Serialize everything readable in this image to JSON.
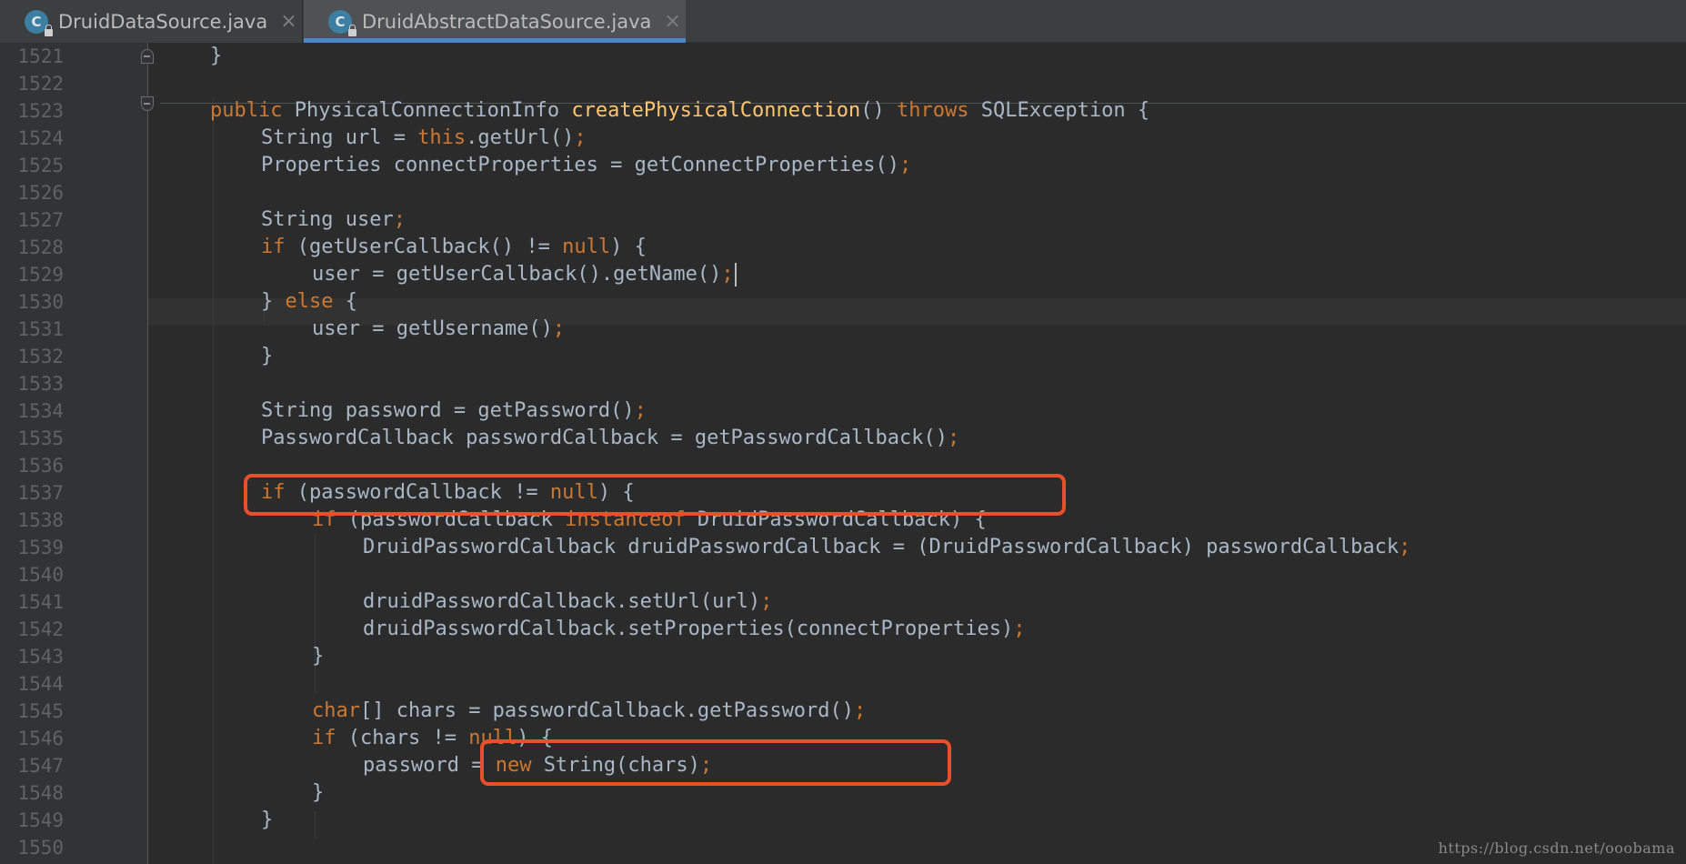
{
  "tabs": [
    {
      "label": "DruidDataSource.java",
      "icon": "java-class-locked-icon",
      "icon_letter": "C",
      "close": "×",
      "active": false
    },
    {
      "label": "DruidAbstractDataSource.java",
      "icon": "java-class-locked-icon",
      "icon_letter": "C",
      "close": "×",
      "active": true
    }
  ],
  "editor": {
    "line_numbers": [
      "1521",
      "1522",
      "1523",
      "1524",
      "1525",
      "1526",
      "1527",
      "1528",
      "1529",
      "1530",
      "1531",
      "1532",
      "1533",
      "1534",
      "1535",
      "1536",
      "1537",
      "1538",
      "1539",
      "1540",
      "1541",
      "1542",
      "1543",
      "1544",
      "1545",
      "1546",
      "1547",
      "1548",
      "1549",
      "1550"
    ],
    "lines": [
      {
        "indent": 1,
        "tokens": [
          {
            "t": "}",
            "k": "plain"
          }
        ]
      },
      {
        "indent": 0,
        "tokens": []
      },
      {
        "indent": 1,
        "tokens": [
          {
            "t": "public ",
            "k": "kw"
          },
          {
            "t": "PhysicalConnectionInfo ",
            "k": "plain"
          },
          {
            "t": "createPhysicalConnection",
            "k": "fn"
          },
          {
            "t": "() ",
            "k": "plain"
          },
          {
            "t": "throws ",
            "k": "kw"
          },
          {
            "t": "SQLException {",
            "k": "plain"
          }
        ]
      },
      {
        "indent": 2,
        "tokens": [
          {
            "t": "String url = ",
            "k": "plain"
          },
          {
            "t": "this",
            "k": "kw"
          },
          {
            "t": ".getUrl()",
            "k": "plain"
          },
          {
            "t": ";",
            "k": "kw"
          }
        ]
      },
      {
        "indent": 2,
        "tokens": [
          {
            "t": "Properties connectProperties = getConnectProperties()",
            "k": "plain"
          },
          {
            "t": ";",
            "k": "kw"
          }
        ]
      },
      {
        "indent": 0,
        "tokens": []
      },
      {
        "indent": 2,
        "tokens": [
          {
            "t": "String user",
            "k": "plain"
          },
          {
            "t": ";",
            "k": "kw"
          }
        ]
      },
      {
        "indent": 2,
        "tokens": [
          {
            "t": "if ",
            "k": "kw"
          },
          {
            "t": "(getUserCallback() != ",
            "k": "plain"
          },
          {
            "t": "null",
            "k": "kw"
          },
          {
            "t": ") {",
            "k": "plain"
          }
        ]
      },
      {
        "indent": 3,
        "tokens": [
          {
            "t": "user = getUserCallback().getName()",
            "k": "plain"
          },
          {
            "t": ";",
            "k": "kw"
          }
        ],
        "caret": true
      },
      {
        "indent": 2,
        "tokens": [
          {
            "t": "} ",
            "k": "plain"
          },
          {
            "t": "else ",
            "k": "kw"
          },
          {
            "t": "{",
            "k": "plain"
          }
        ]
      },
      {
        "indent": 3,
        "tokens": [
          {
            "t": "user = getUsername()",
            "k": "plain"
          },
          {
            "t": ";",
            "k": "kw"
          }
        ]
      },
      {
        "indent": 2,
        "tokens": [
          {
            "t": "}",
            "k": "plain"
          }
        ]
      },
      {
        "indent": 0,
        "tokens": []
      },
      {
        "indent": 2,
        "tokens": [
          {
            "t": "String password = getPassword()",
            "k": "plain"
          },
          {
            "t": ";",
            "k": "kw"
          }
        ]
      },
      {
        "indent": 2,
        "tokens": [
          {
            "t": "PasswordCallback passwordCallback = getPasswordCallback()",
            "k": "plain"
          },
          {
            "t": ";",
            "k": "kw"
          }
        ]
      },
      {
        "indent": 0,
        "tokens": []
      },
      {
        "indent": 2,
        "tokens": [
          {
            "t": "if ",
            "k": "kw"
          },
          {
            "t": "(passwordCallback != ",
            "k": "plain"
          },
          {
            "t": "null",
            "k": "kw"
          },
          {
            "t": ") {",
            "k": "plain"
          }
        ]
      },
      {
        "indent": 3,
        "tokens": [
          {
            "t": "if ",
            "k": "kw"
          },
          {
            "t": "(passwordCallback ",
            "k": "plain"
          },
          {
            "t": "instanceof ",
            "k": "kw"
          },
          {
            "t": "DruidPasswordCallback) {",
            "k": "plain"
          }
        ]
      },
      {
        "indent": 4,
        "tokens": [
          {
            "t": "DruidPasswordCallback druidPasswordCallback = (DruidPasswordCallback) passwordCallback",
            "k": "plain"
          },
          {
            "t": ";",
            "k": "kw"
          }
        ]
      },
      {
        "indent": 0,
        "tokens": []
      },
      {
        "indent": 4,
        "tokens": [
          {
            "t": "druidPasswordCallback.setUrl(url)",
            "k": "plain"
          },
          {
            "t": ";",
            "k": "kw"
          }
        ]
      },
      {
        "indent": 4,
        "tokens": [
          {
            "t": "druidPasswordCallback.setProperties(connectProperties)",
            "k": "plain"
          },
          {
            "t": ";",
            "k": "kw"
          }
        ]
      },
      {
        "indent": 3,
        "tokens": [
          {
            "t": "}",
            "k": "plain"
          }
        ]
      },
      {
        "indent": 0,
        "tokens": []
      },
      {
        "indent": 3,
        "tokens": [
          {
            "t": "char",
            "k": "kw"
          },
          {
            "t": "[] chars = passwordCallback.getPassword()",
            "k": "plain"
          },
          {
            "t": ";",
            "k": "kw"
          }
        ]
      },
      {
        "indent": 3,
        "tokens": [
          {
            "t": "if ",
            "k": "kw"
          },
          {
            "t": "(chars != ",
            "k": "plain"
          },
          {
            "t": "null",
            "k": "kw"
          },
          {
            "t": ") {",
            "k": "plain"
          }
        ]
      },
      {
        "indent": 4,
        "tokens": [
          {
            "t": "password = ",
            "k": "plain"
          },
          {
            "t": "new ",
            "k": "kw"
          },
          {
            "t": "String(chars)",
            "k": "plain"
          },
          {
            "t": ";",
            "k": "kw"
          }
        ]
      },
      {
        "indent": 3,
        "tokens": [
          {
            "t": "}",
            "k": "plain"
          }
        ]
      },
      {
        "indent": 2,
        "tokens": [
          {
            "t": "}",
            "k": "plain"
          }
        ]
      },
      {
        "indent": 0,
        "tokens": []
      }
    ]
  },
  "watermark": "https://blog.csdn.net/ooobama",
  "colors": {
    "background": "#2b2b2b",
    "gutter": "#313335",
    "keyword": "#cc7832",
    "method": "#ffc66d",
    "text": "#a9b7c6",
    "annotation_box": "#e8502b",
    "tab_accent": "#4a88c7"
  }
}
